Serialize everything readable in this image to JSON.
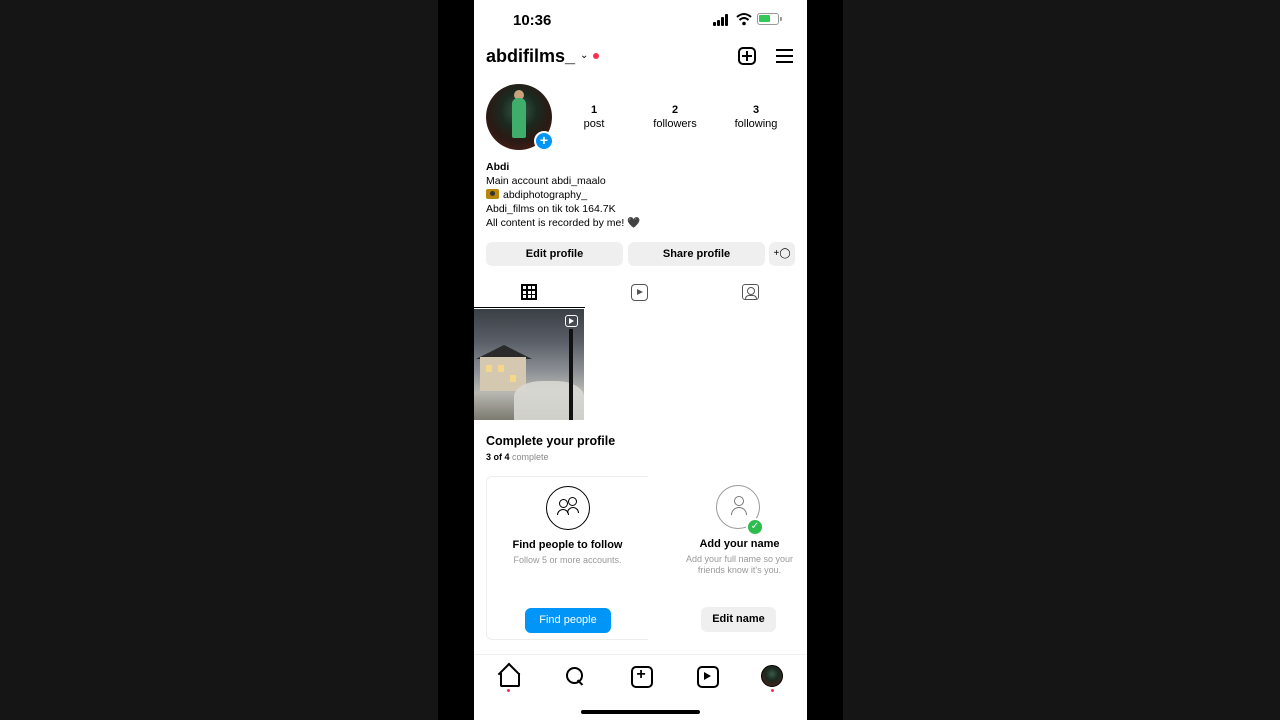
{
  "status": {
    "time": "10:36"
  },
  "header": {
    "username": "abdifilms_"
  },
  "stats": [
    {
      "value": "1",
      "label": "post"
    },
    {
      "value": "2",
      "label": "followers"
    },
    {
      "value": "3",
      "label": "following"
    }
  ],
  "bio": {
    "name": "Abdi",
    "line1": "Main account abdi_maalo",
    "line2": "abdiphotography_",
    "line3": "Abdi_films on tik tok 164.7K",
    "line4": "All content is recorded by me!",
    "heart": "🖤"
  },
  "actions": {
    "edit": "Edit profile",
    "share": "Share profile"
  },
  "complete": {
    "title": "Complete your profile",
    "progress": "3 of 4",
    "progress_suffix": "complete",
    "cards": [
      {
        "title": "Find people to follow",
        "desc": "Follow 5 or more accounts.",
        "button": "Find people",
        "icon": "people-icon",
        "done": false
      },
      {
        "title": "Add your name",
        "desc": "Add your full name so your friends know it's you.",
        "button": "Edit name",
        "icon": "person-icon",
        "done": true
      }
    ]
  },
  "colors": {
    "accent": "#0095f6",
    "badge": "#ff2d55",
    "check": "#2dbd4e"
  }
}
